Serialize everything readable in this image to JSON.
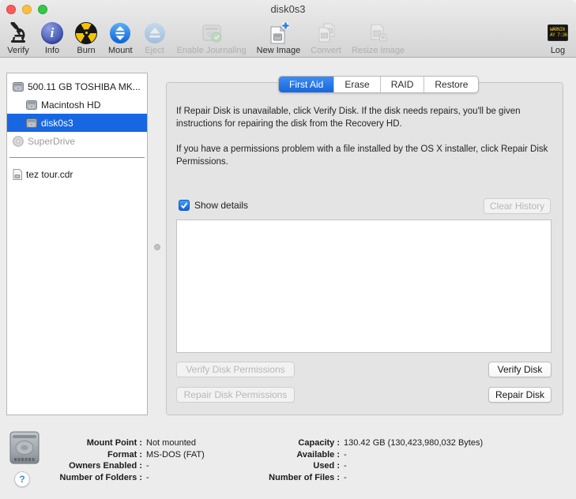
{
  "window": {
    "title": "disk0s3"
  },
  "colors": {
    "selection_blue": "#1867e2",
    "tab_selected_blue": "#1767dd",
    "log_warning_yellow": "#edc31c"
  },
  "toolbar": {
    "items": [
      {
        "label": "Verify",
        "enabled": true
      },
      {
        "label": "Info",
        "enabled": true
      },
      {
        "label": "Burn",
        "enabled": true
      },
      {
        "label": "Mount",
        "enabled": true
      },
      {
        "label": "Eject",
        "enabled": false
      },
      {
        "label": "Enable Journaling",
        "enabled": false
      },
      {
        "label": "New Image",
        "enabled": true
      },
      {
        "label": "Convert",
        "enabled": false
      },
      {
        "label": "Resize Image",
        "enabled": false
      },
      {
        "label": "Log",
        "enabled": true
      }
    ],
    "log_icon_lines": [
      "WARNIN",
      "AY 7:36"
    ]
  },
  "sidebar": {
    "items": [
      {
        "label": "500.11 GB TOSHIBA MK...",
        "selected": false
      },
      {
        "label": "Macintosh HD",
        "selected": false
      },
      {
        "label": "disk0s3",
        "selected": true
      },
      {
        "label": "SuperDrive",
        "selected": false
      },
      {
        "label": "tez tour.cdr",
        "selected": false
      }
    ]
  },
  "tabs": [
    {
      "label": "First Aid",
      "selected": true
    },
    {
      "label": "Erase",
      "selected": false
    },
    {
      "label": "RAID",
      "selected": false
    },
    {
      "label": "Restore",
      "selected": false
    }
  ],
  "first_aid": {
    "intro_1": "If Repair Disk is unavailable, click Verify Disk. If the disk needs repairs, you'll be given instructions for repairing the disk from the Recovery HD.",
    "intro_2": "If you have a permissions problem with a file installed by the OS X installer, click Repair Disk Permissions.",
    "show_details_label": "Show details",
    "show_details_checked": true,
    "clear_history_label": "Clear History",
    "verify_permissions_label": "Verify Disk Permissions",
    "repair_permissions_label": "Repair Disk Permissions",
    "verify_disk_label": "Verify Disk",
    "repair_disk_label": "Repair Disk",
    "log_output": ""
  },
  "footer": {
    "help_glyph": "?",
    "info_left": [
      {
        "label": "Mount Point :",
        "value": "Not mounted"
      },
      {
        "label": "Format :",
        "value": "MS-DOS (FAT)"
      },
      {
        "label": "Owners Enabled :",
        "value": "-"
      },
      {
        "label": "Number of Folders :",
        "value": "-"
      }
    ],
    "info_right": [
      {
        "label": "Capacity :",
        "value": "130.42 GB (130,423,980,032 Bytes)"
      },
      {
        "label": "Available :",
        "value": "-"
      },
      {
        "label": "Used :",
        "value": "-"
      },
      {
        "label": "Number of Files :",
        "value": "-"
      }
    ]
  }
}
